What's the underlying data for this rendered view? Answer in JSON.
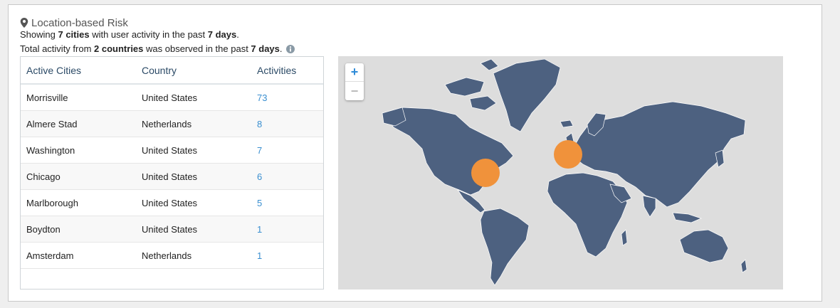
{
  "header": {
    "title": "Location-based Risk",
    "line1": {
      "pre": "Showing ",
      "b1": "7 cities",
      "mid": " with user activity in the past ",
      "b2": "7 days",
      "post": "."
    },
    "line2": {
      "pre": "Total activity from ",
      "b1": "2 countries",
      "mid": " was observed in the past ",
      "b2": "7 days",
      "post": "."
    }
  },
  "table": {
    "headers": [
      "Active Cities",
      "Country",
      "Activities"
    ],
    "rows": [
      {
        "city": "Morrisville",
        "country": "United States",
        "activities": "73"
      },
      {
        "city": "Almere Stad",
        "country": "Netherlands",
        "activities": "8"
      },
      {
        "city": "Washington",
        "country": "United States",
        "activities": "7"
      },
      {
        "city": "Chicago",
        "country": "United States",
        "activities": "6"
      },
      {
        "city": "Marlborough",
        "country": "United States",
        "activities": "5"
      },
      {
        "city": "Boydton",
        "country": "United States",
        "activities": "1"
      },
      {
        "city": "Amsterdam",
        "country": "Netherlands",
        "activities": "1"
      }
    ]
  },
  "map": {
    "zoom_in": "+",
    "zoom_out": "−",
    "land_color": "#4d6180",
    "ocean_color": "#dddddd",
    "marker_color": "#f0923b"
  }
}
